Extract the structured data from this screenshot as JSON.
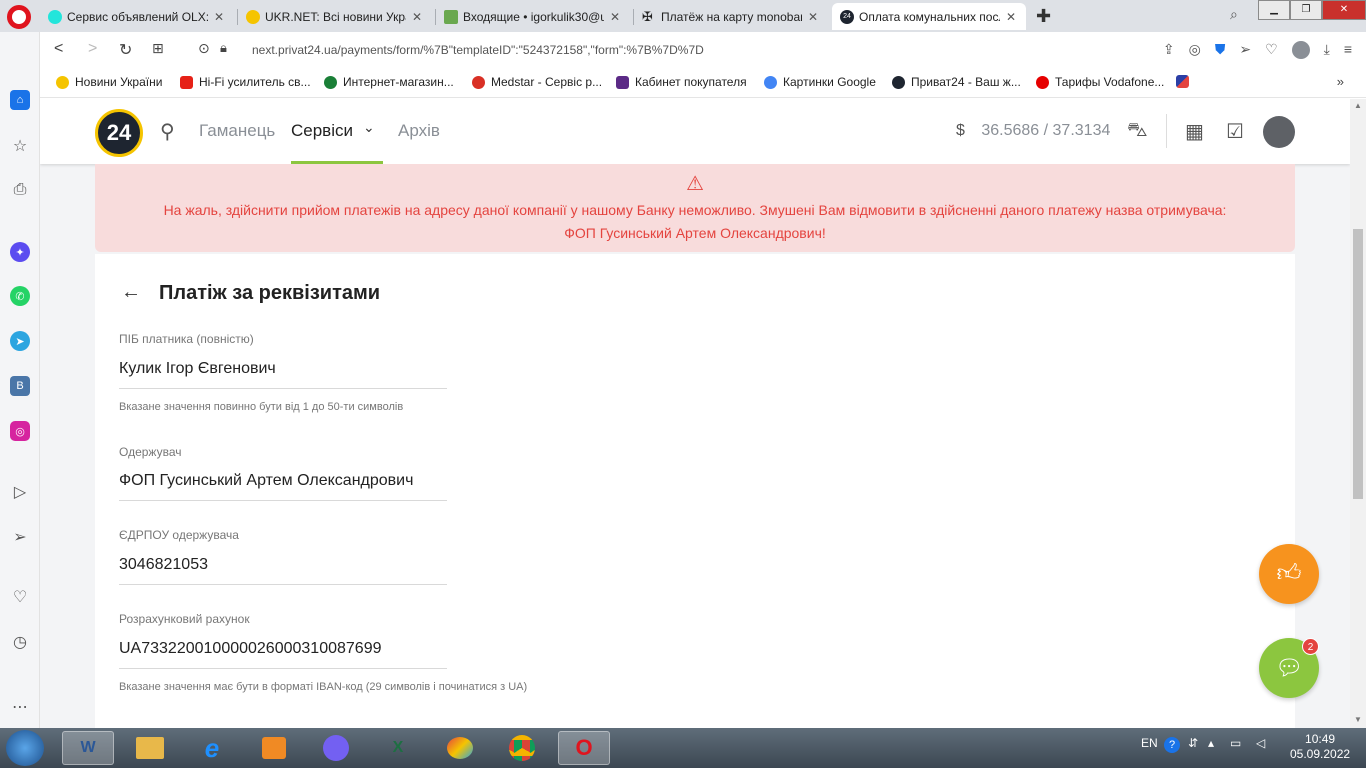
{
  "tabs": [
    {
      "title": "Сервис объявлений OLX: ",
      "color": "#23e5db",
      "active": false
    },
    {
      "title": "UKR.NET: Всі новини Украї",
      "color": "#f5c400",
      "active": false
    },
    {
      "title": "Входящие • igorkulik30@u",
      "color": "#6aa84f",
      "active": false
    },
    {
      "title": "Платёж на карту monobar",
      "color": "#222222",
      "active": false
    },
    {
      "title": "Оплата комунальних посл",
      "color": "#1e2530",
      "active": true
    }
  ],
  "address": {
    "url": "next.privat24.ua/payments/form/%7B\"templateID\":\"524372158\",\"form\":%7B%7D%7D"
  },
  "bookmarks": [
    {
      "label": "Новини України",
      "color": "#f5c400"
    },
    {
      "label": "Hi-Fi усилитель св...",
      "color": "#e62117"
    },
    {
      "label": "Интернет-магазин...",
      "color": "#1a7f37"
    },
    {
      "label": "Medstar - Сервіс р...",
      "color": "#d93025"
    },
    {
      "label": "Кабинет покупателя",
      "color": "#5b2a86"
    },
    {
      "label": "Картинки Google",
      "color": "#4285f4"
    },
    {
      "label": "Приват24 - Ваш ж...",
      "color": "#1e2530"
    },
    {
      "label": "Тарифы Vodafone...",
      "color": "#e60000"
    }
  ],
  "header": {
    "logo": "24",
    "nav": [
      {
        "label": "Гаманець",
        "active": false
      },
      {
        "label": "Сервіси",
        "active": true
      },
      {
        "label": "Архів",
        "active": false
      }
    ],
    "currency": "$",
    "rate": "36.5686 / 37.3134"
  },
  "alert": {
    "line1": "На жаль, здійснити прийом платежів на адресу даної компанії у нашому Банку неможливо. Змушені Вам відмовити в здійсненні даного платежу назва отримувача:",
    "line2": "ФОП Гусинський Артем Олександрович!"
  },
  "form": {
    "title": "Платіж за реквізитами",
    "fields": [
      {
        "label": "ПІБ платника (повністю)",
        "value": "Кулик Ігор Євгенович",
        "hint": "Вказане значення повинно бути від 1 до 50-ти символів"
      },
      {
        "label": "Одержувач",
        "value": "ФОП Гусинський Артем Олександрович",
        "hint": ""
      },
      {
        "label": "ЄДРПОУ одержувача",
        "value": "3046821053",
        "hint": ""
      },
      {
        "label": "Розрахунковий рахунок",
        "value": "UA733220010000026000310087699",
        "hint": "Вказане значення має бути в форматі IBAN-код (29 символів і починатися з UA)"
      }
    ]
  },
  "chat_badge": "2",
  "taskbar": {
    "apps": [
      "W",
      "",
      "e",
      "",
      "",
      "X",
      "",
      "",
      "O"
    ],
    "lang": "EN",
    "time": "10:49",
    "date": "05.09.2022"
  }
}
